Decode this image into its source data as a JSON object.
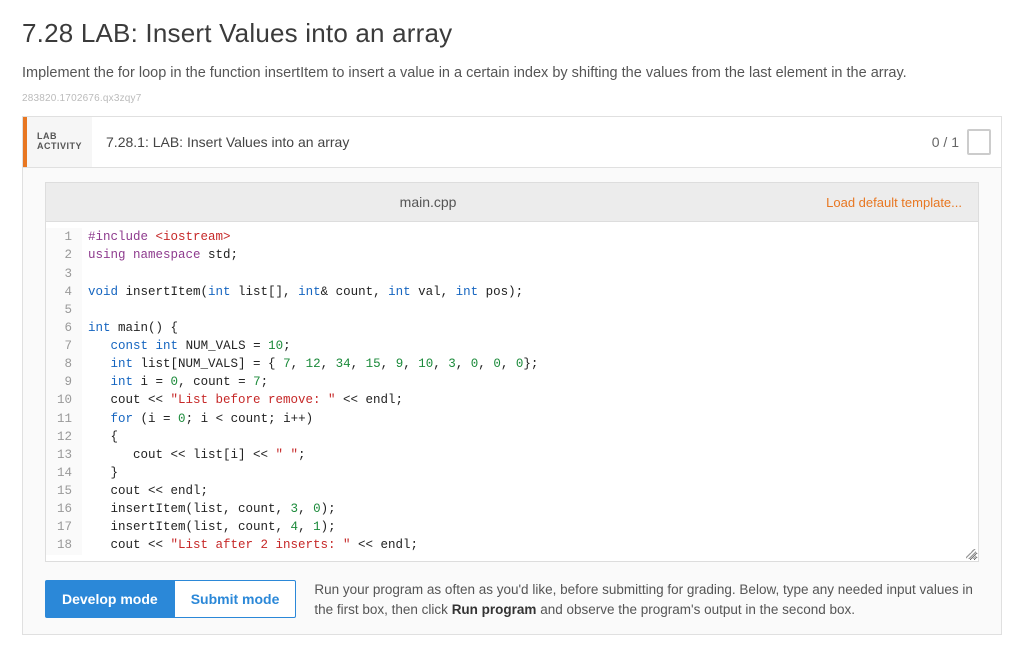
{
  "title": "7.28 LAB: Insert Values into an array",
  "description": "Implement the for loop in the function insertItem to insert a value in a certain index by shifting the values from the last element in the array.",
  "doc_id": "283820.1702676.qx3zqy7",
  "activity": {
    "badge_line1": "LAB",
    "badge_line2": "ACTIVITY",
    "title": "7.28.1: LAB: Insert Values into an array",
    "score": "0 / 1"
  },
  "file": {
    "name": "main.cpp",
    "load_template": "Load default template..."
  },
  "modes": {
    "develop": "Develop mode",
    "submit": "Submit mode",
    "hint_prefix": "Run your program as often as you'd like, before submitting for grading. Below, type any needed input values in the first box, then click ",
    "hint_bold": "Run program",
    "hint_suffix": " and observe the program's output in the second box."
  },
  "code_lines": [
    {
      "n": 1,
      "html": "<span class='pp'>#include</span> <span class='str'>&lt;iostream&gt;</span>"
    },
    {
      "n": 2,
      "html": "<span class='pp'>using</span> <span class='pp'>namespace</span> std;"
    },
    {
      "n": 3,
      "html": ""
    },
    {
      "n": 4,
      "html": "<span class='kw'>void</span> insertItem(<span class='kw'>int</span> list[], <span class='kw'>int</span>&amp; count, <span class='kw'>int</span> val, <span class='kw'>int</span> pos);"
    },
    {
      "n": 5,
      "html": ""
    },
    {
      "n": 6,
      "html": "<span class='kw'>int</span> main() {"
    },
    {
      "n": 7,
      "html": "   <span class='kw'>const</span> <span class='kw'>int</span> NUM_VALS = <span class='num'>10</span>;"
    },
    {
      "n": 8,
      "html": "   <span class='kw'>int</span> list[NUM_VALS] = { <span class='num'>7</span>, <span class='num'>12</span>, <span class='num'>34</span>, <span class='num'>15</span>, <span class='num'>9</span>, <span class='num'>10</span>, <span class='num'>3</span>, <span class='num'>0</span>, <span class='num'>0</span>, <span class='num'>0</span>};"
    },
    {
      "n": 9,
      "html": "   <span class='kw'>int</span> i = <span class='num'>0</span>, count = <span class='num'>7</span>;"
    },
    {
      "n": 10,
      "html": "   cout &lt;&lt; <span class='str'>\"List before remove: \"</span> &lt;&lt; endl;"
    },
    {
      "n": 11,
      "html": "   <span class='kw'>for</span> (i = <span class='num'>0</span>; i &lt; count; i++)"
    },
    {
      "n": 12,
      "html": "   {"
    },
    {
      "n": 13,
      "html": "      cout &lt;&lt; list[i] &lt;&lt; <span class='str'>\" \"</span>;"
    },
    {
      "n": 14,
      "html": "   }"
    },
    {
      "n": 15,
      "html": "   cout &lt;&lt; endl;"
    },
    {
      "n": 16,
      "html": "   insertItem(list, count, <span class='num'>3</span>, <span class='num'>0</span>);"
    },
    {
      "n": 17,
      "html": "   insertItem(list, count, <span class='num'>4</span>, <span class='num'>1</span>);"
    },
    {
      "n": 18,
      "html": "   cout &lt;&lt; <span class='str'>\"List after 2 inserts: \"</span> &lt;&lt; endl;"
    }
  ]
}
